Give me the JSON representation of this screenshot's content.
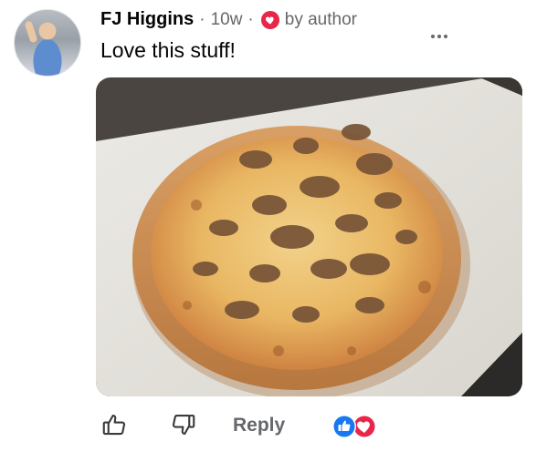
{
  "comment": {
    "author_name": "FJ Higgins",
    "time": "10w",
    "separator": "·",
    "author_badge": "by author",
    "text": "Love this stuff!"
  },
  "actions": {
    "reply_label": "Reply"
  },
  "colors": {
    "meta_gray": "#65676b",
    "heart_red": "#e8264a",
    "like_blue": "#1877f2"
  },
  "icons": {
    "more": "more-horizontal-icon",
    "like": "thumbs-up-outline-icon",
    "dislike": "thumbs-down-outline-icon",
    "author_heart": "heart-badge-icon",
    "reactions": [
      "like-reaction-icon",
      "love-reaction-icon"
    ]
  }
}
